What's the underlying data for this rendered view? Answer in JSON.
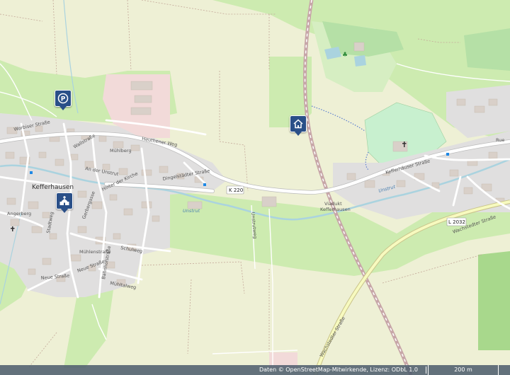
{
  "map": {
    "place_name": "Kefferhausen",
    "streets": {
      "worbiser": "Worbiser Straße",
      "wallstrasse": "Wallstraße",
      "heuthener": "Heuthener Weg",
      "muehlberg": "Mühlberg",
      "an_der_unstrut": "An der Unstrut",
      "dingelstaedter": "Dingelstädter Straße",
      "hinter_der_kirche": "Hinter der Kirche",
      "angerberg": "Angerberg",
      "gerbergasse": "Gerbergasse",
      "stadtweg": "Stadtweg",
      "muehlenstrasse": "Mühlenstraße",
      "schulweg": "Schulweg",
      "neue_strasse": "Neue Straße",
      "bahnhofstrasse": "Bahnhofstraße",
      "muehltalweg": "Mühltalweg",
      "unstrutweg": "Unstrutweg",
      "kefferhaeuser": "Kefferhäuser Straße",
      "wachstedter": "Wachstedter Straße",
      "rue": "Rue"
    },
    "road_refs": {
      "k220": "K 220",
      "l2032": "L 2032"
    },
    "water": {
      "unstrut_1": "Unstrut",
      "unstrut_2": "Unstrut"
    },
    "viaduct": {
      "line1": "Viadukt",
      "line2": "Kefferhausen"
    },
    "markers": {
      "parking": "parking-icon",
      "home": "home-icon",
      "church": "church-icon"
    },
    "colors": {
      "marker": "#2a4f88",
      "residential": "#e0dfdf",
      "meadow": "#cdebb0",
      "farmland": "#eef0d5",
      "water": "#aad3df",
      "road": "#ffffff",
      "secondary_road": "#f7fabf",
      "railway": "#c7a6a8"
    }
  },
  "footer": {
    "attribution": "Daten © OpenStreetMap-Mitwirkende, Lizenz: ODbL 1.0",
    "scale_label": "200 m"
  }
}
